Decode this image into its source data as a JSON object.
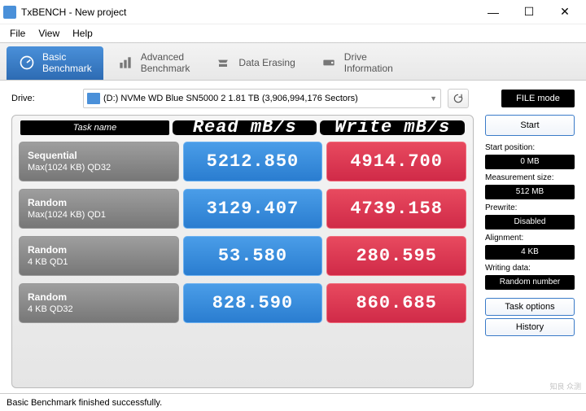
{
  "window": {
    "title": "TxBENCH - New project"
  },
  "menu": {
    "file": "File",
    "view": "View",
    "help": "Help"
  },
  "tabs": [
    {
      "line1": "Basic",
      "line2": "Benchmark"
    },
    {
      "line1": "Advanced",
      "line2": "Benchmark"
    },
    {
      "line1": "Data Erasing",
      "line2": ""
    },
    {
      "line1": "Drive",
      "line2": "Information"
    }
  ],
  "drive": {
    "label": "Drive:",
    "value": "(D:) NVMe WD Blue SN5000 2  1.81 TB (3,906,994,176 Sectors)",
    "file_mode": "FILE mode"
  },
  "headers": {
    "task": "Task name",
    "read": "Read mB/s",
    "write": "Write mB/s"
  },
  "rows": [
    {
      "t1": "Sequential",
      "t2": "Max(1024 KB) QD32",
      "read": "5212.850",
      "write": "4914.700"
    },
    {
      "t1": "Random",
      "t2": "Max(1024 KB) QD1",
      "read": "3129.407",
      "write": "4739.158"
    },
    {
      "t1": "Random",
      "t2": "4 KB QD1",
      "read": "53.580",
      "write": "280.595"
    },
    {
      "t1": "Random",
      "t2": "4 KB QD32",
      "read": "828.590",
      "write": "860.685"
    }
  ],
  "side": {
    "start": "Start",
    "start_pos_lbl": "Start position:",
    "start_pos": "0 MB",
    "meas_lbl": "Measurement size:",
    "meas": "512 MB",
    "prewrite_lbl": "Prewrite:",
    "prewrite": "Disabled",
    "align_lbl": "Alignment:",
    "align": "4 KB",
    "writedata_lbl": "Writing data:",
    "writedata": "Random number",
    "task_options": "Task options",
    "history": "History"
  },
  "status": "Basic Benchmark finished successfully.",
  "watermark": "知良 众测"
}
